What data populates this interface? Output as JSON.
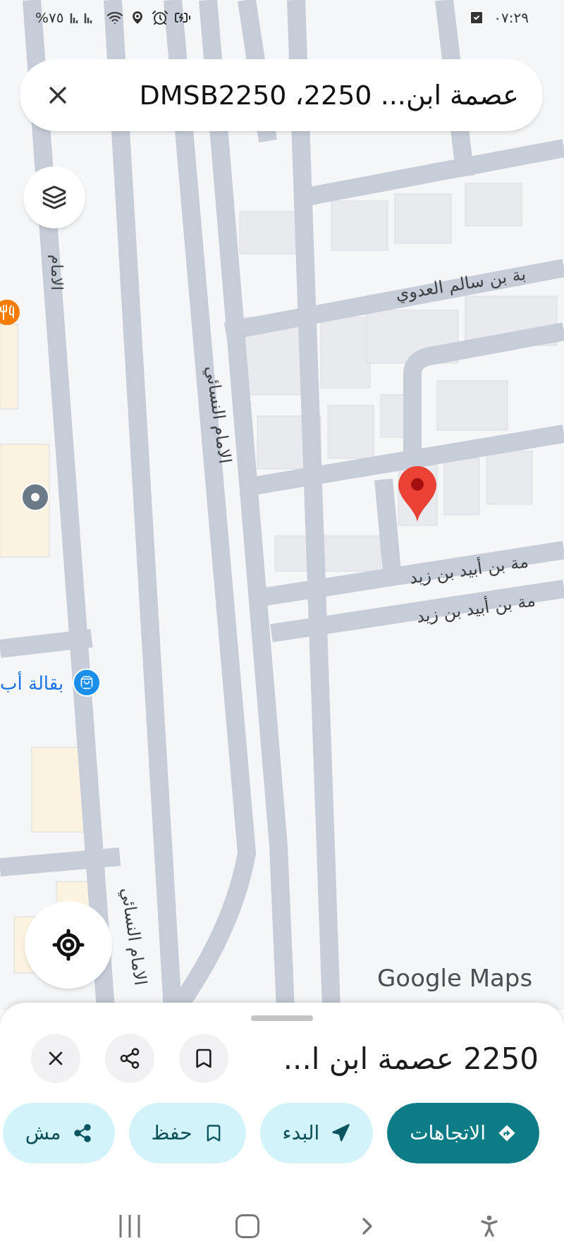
{
  "status_bar": {
    "battery": "%٧٥",
    "time": "٠٧:٢٩"
  },
  "search_bar": {
    "query": "عصمة ابن... 2250، DMSB2250"
  },
  "map": {
    "labels": [
      {
        "text": "الامام",
        "kind": "street"
      },
      {
        "text": "بة بن سالم العدوي",
        "kind": "street"
      },
      {
        "text": "الامام النسائي",
        "kind": "street"
      },
      {
        "text": "مة بن أبيد بن زيد",
        "kind": "street"
      },
      {
        "text": "مة بن أبيد بن زيد",
        "kind": "street"
      },
      {
        "text": "الامام النسائي",
        "kind": "street"
      },
      {
        "text": "بقالة أب",
        "kind": "place"
      }
    ],
    "attribution": "Google Maps"
  },
  "place_sheet": {
    "title": "2250 عصمة ابن ا...",
    "actions": [
      {
        "label": "الاتجاهات",
        "kind": "directions",
        "primary": true
      },
      {
        "label": "البدء",
        "kind": "start",
        "primary": false
      },
      {
        "label": "حفظ",
        "kind": "save",
        "primary": false
      },
      {
        "label": "مش",
        "kind": "share",
        "primary": false
      }
    ]
  }
}
